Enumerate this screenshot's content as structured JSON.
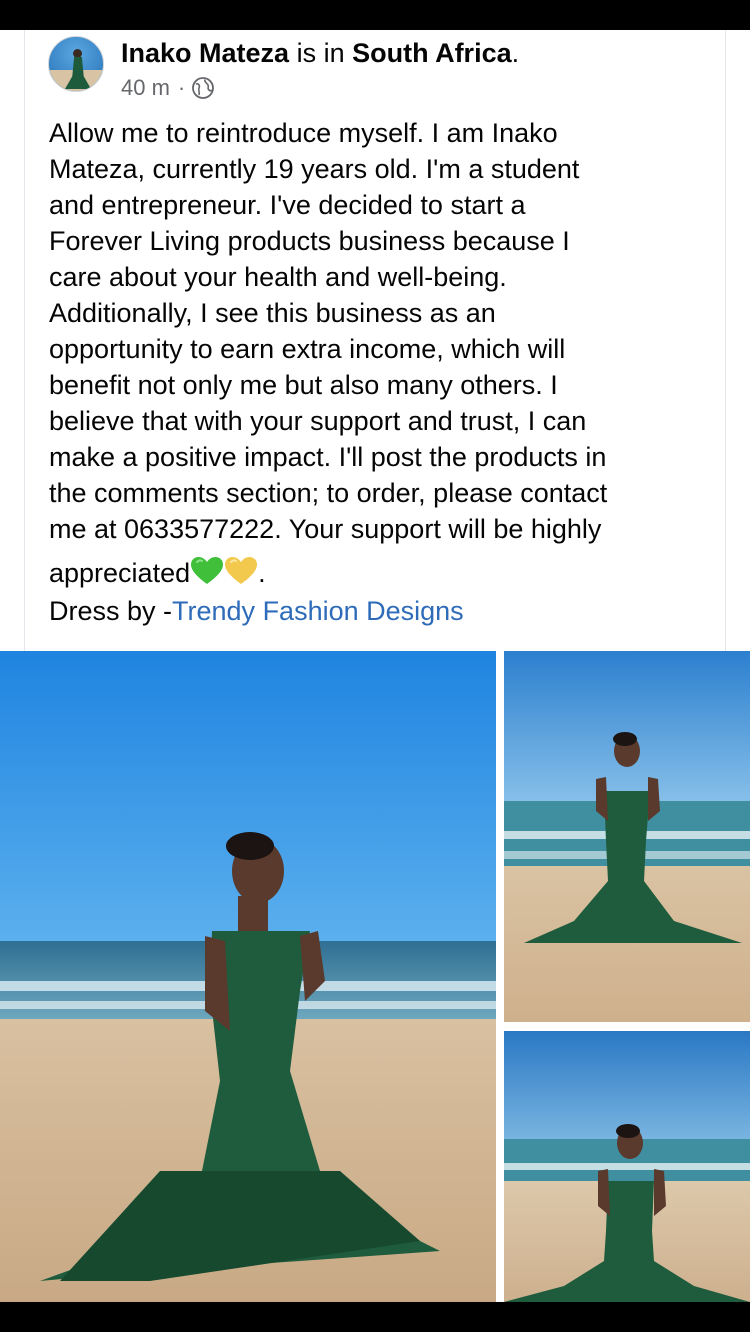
{
  "post": {
    "author_name": "Inako Mateza",
    "location_connector": " is in ",
    "location": "South Africa",
    "location_suffix": ".",
    "timestamp": "40 m",
    "separator": "·",
    "audience_icon": "globe-icon",
    "body_lines": [
      "Allow me to reintroduce myself. I am Inako",
      "Mateza, currently 19 years old. I'm a student",
      "and entrepreneur. I've decided to start a",
      "Forever Living products business because I",
      "care about your health and well-being.",
      "Additionally, I see this business as an",
      "opportunity to earn extra income, which will",
      "benefit not only me but also many others. I",
      "believe that with your support and trust, I can",
      "make a positive impact. I'll post the products in",
      "the comments section; to order, please contact",
      "me at 0633577222. Your support will be highly"
    ],
    "last_line_text": "appreciated",
    "last_line_emojis": [
      "green-heart-emoji",
      "yellow-heart-emoji"
    ],
    "last_line_end": ".",
    "credit_prefix": "Dress by -",
    "credit_link": "Trendy Fashion Designs",
    "link_color": "#2e6bb8"
  },
  "photos": [
    {
      "name": "photo-main",
      "subject": "woman in green mermaid gown on beach"
    },
    {
      "name": "photo-top-right",
      "subject": "woman in green gown standing by the sea"
    },
    {
      "name": "photo-bottom-right",
      "subject": "woman in green gown smiling on beach"
    }
  ],
  "colors": {
    "dress_green": "#1f5b3d",
    "sky_blue": "#2f8fe0",
    "sand": "#d9c3a3"
  }
}
